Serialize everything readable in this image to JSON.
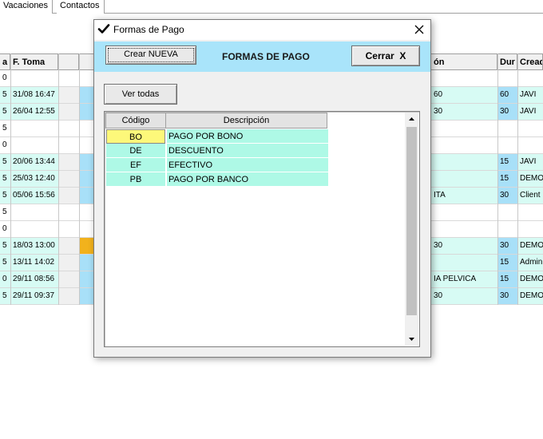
{
  "tabs": [
    "Vacaciones",
    "Contactos"
  ],
  "grid": {
    "headers": [
      "a",
      "F. Toma",
      "",
      "",
      "ón",
      "Dur",
      "Cread"
    ],
    "rows": [
      {
        "a": "0",
        "fecha": "",
        "desc": "",
        "dur": "",
        "creado": "",
        "style": "plain"
      },
      {
        "a": "5",
        "fecha": "31/08 16:47",
        "desc": "60",
        "dur": "60",
        "creado": "JAVI",
        "style": "cyan"
      },
      {
        "a": "5",
        "fecha": "26/04 12:55",
        "desc": "30",
        "dur": "30",
        "creado": "JAVI",
        "style": "cyan"
      },
      {
        "a": "5",
        "fecha": "",
        "desc": "",
        "dur": "",
        "creado": "",
        "style": "plain"
      },
      {
        "a": "0",
        "fecha": "",
        "desc": "",
        "dur": "",
        "creado": "",
        "style": "plain"
      },
      {
        "a": "5",
        "fecha": "20/06 13:44",
        "desc": "",
        "dur": "15",
        "creado": "JAVI",
        "style": "cyan"
      },
      {
        "a": "5",
        "fecha": "25/03 12:40",
        "desc": "",
        "dur": "15",
        "creado": "DEMO",
        "style": "cyan"
      },
      {
        "a": "5",
        "fecha": "05/06 15:56",
        "desc": "ITA",
        "dur": "30",
        "creado": "Client",
        "style": "cyan"
      },
      {
        "a": "5",
        "fecha": "",
        "desc": "",
        "dur": "",
        "creado": "",
        "style": "plain"
      },
      {
        "a": "0",
        "fecha": "",
        "desc": "",
        "dur": "",
        "creado": "",
        "style": "plain"
      },
      {
        "a": "5",
        "fecha": "18/03 13:00",
        "desc": "30",
        "dur": "30",
        "creado": "DEMO",
        "style": "cyan",
        "orange": true
      },
      {
        "a": "5",
        "fecha": "13/11 14:02",
        "desc": "",
        "dur": "15",
        "creado": "Admin",
        "style": "cyan"
      },
      {
        "a": "0",
        "fecha": "29/11 08:56",
        "desc": "IA PELVICA",
        "dur": "15",
        "creado": "DEMO",
        "style": "cyan"
      },
      {
        "a": "5",
        "fecha": "29/11 09:37",
        "desc": "30",
        "dur": "30",
        "creado": "DEMO",
        "style": "cyan"
      }
    ]
  },
  "modal": {
    "title": "Formas de Pago",
    "header_title": "FORMAS DE PAGO",
    "new_button": "Crear NUEVA",
    "close_button": "Cerrar  X",
    "view_all_button": "Ver todas",
    "columns": {
      "code": "Código",
      "description": "Descripción"
    },
    "items": [
      {
        "code": "BO",
        "description": "PAGO POR BONO",
        "selected": true
      },
      {
        "code": "DE",
        "description": "DESCUENTO",
        "selected": false
      },
      {
        "code": "EF",
        "description": "EFECTIVO",
        "selected": false
      },
      {
        "code": "PB",
        "description": "PAGO POR BANCO",
        "selected": false
      }
    ]
  },
  "colors": {
    "header_blue": "#a9e4fa",
    "row_cyan": "#aef9e6",
    "selected_yellow": "#fdf87a",
    "grid_cyan": "#d7fbf4",
    "grid_blue": "#a8e0f8",
    "orange": "#f2b21c"
  },
  "icons": {
    "title": "checkmark-icon",
    "close": "close-icon",
    "scroll_up": "arrow-up-icon",
    "scroll_down": "arrow-down-icon"
  }
}
